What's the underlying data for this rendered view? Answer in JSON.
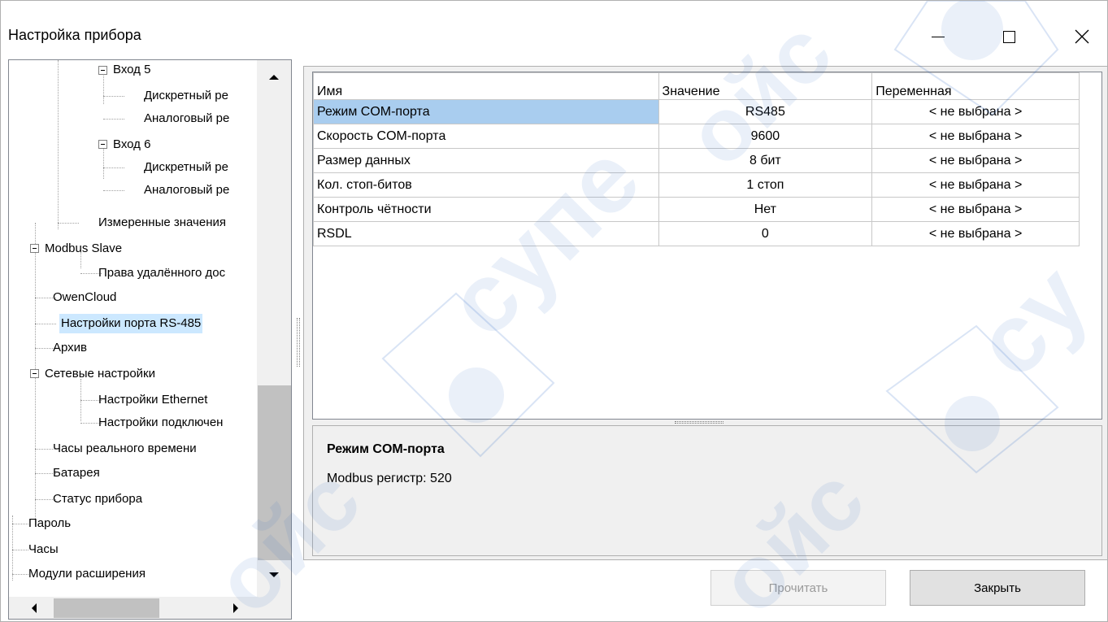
{
  "window": {
    "title": "Настройка прибора",
    "minimize_icon": "minimize-icon",
    "maximize_icon": "maximize-icon",
    "close_icon": "close-icon"
  },
  "tree": {
    "items": [
      {
        "label": "Вход 5",
        "expanded": true
      },
      {
        "label": "Дискретный ре"
      },
      {
        "label": "Аналоговый ре"
      },
      {
        "label": "Вход 6",
        "expanded": true
      },
      {
        "label": "Дискретный ре"
      },
      {
        "label": "Аналоговый ре"
      },
      {
        "label": "Измеренные значения"
      },
      {
        "label": "Modbus Slave",
        "expanded": true
      },
      {
        "label": "Права удалённого дос"
      },
      {
        "label": "OwenCloud"
      },
      {
        "label": "Настройки порта RS-485",
        "selected": true
      },
      {
        "label": "Архив"
      },
      {
        "label": "Сетевые настройки",
        "expanded": true
      },
      {
        "label": "Настройки Ethernet"
      },
      {
        "label": "Настройки подключен"
      },
      {
        "label": "Часы реального времени"
      },
      {
        "label": "Батарея"
      },
      {
        "label": "Статус прибора"
      },
      {
        "label": "Пароль"
      },
      {
        "label": "Часы"
      },
      {
        "label": "Модули расширения"
      }
    ]
  },
  "grid": {
    "columns": [
      "Имя",
      "Значение",
      "Переменная"
    ],
    "rows": [
      {
        "name": "Режим COM-порта",
        "value": "RS485",
        "variable": "< не выбрана >",
        "selected": true
      },
      {
        "name": "Скорость COM-порта",
        "value": "9600",
        "variable": "< не выбрана >"
      },
      {
        "name": "Размер данных",
        "value": "8 бит",
        "variable": "< не выбрана >"
      },
      {
        "name": "Кол. стоп-битов",
        "value": "1 стоп",
        "variable": "< не выбрана >"
      },
      {
        "name": "Контроль чётности",
        "value": "Нет",
        "variable": "< не выбрана >"
      },
      {
        "name": "RSDL",
        "value": "0",
        "variable": "< не выбрана >"
      }
    ]
  },
  "info": {
    "title": "Режим COM-порта",
    "text": "Modbus регистр: 520"
  },
  "buttons": {
    "read": "Прочитать",
    "close": "Закрыть"
  },
  "colors": {
    "selection": "#cce8ff",
    "grid_selection": "#a9cdef",
    "watermark": "#2f67c6"
  }
}
